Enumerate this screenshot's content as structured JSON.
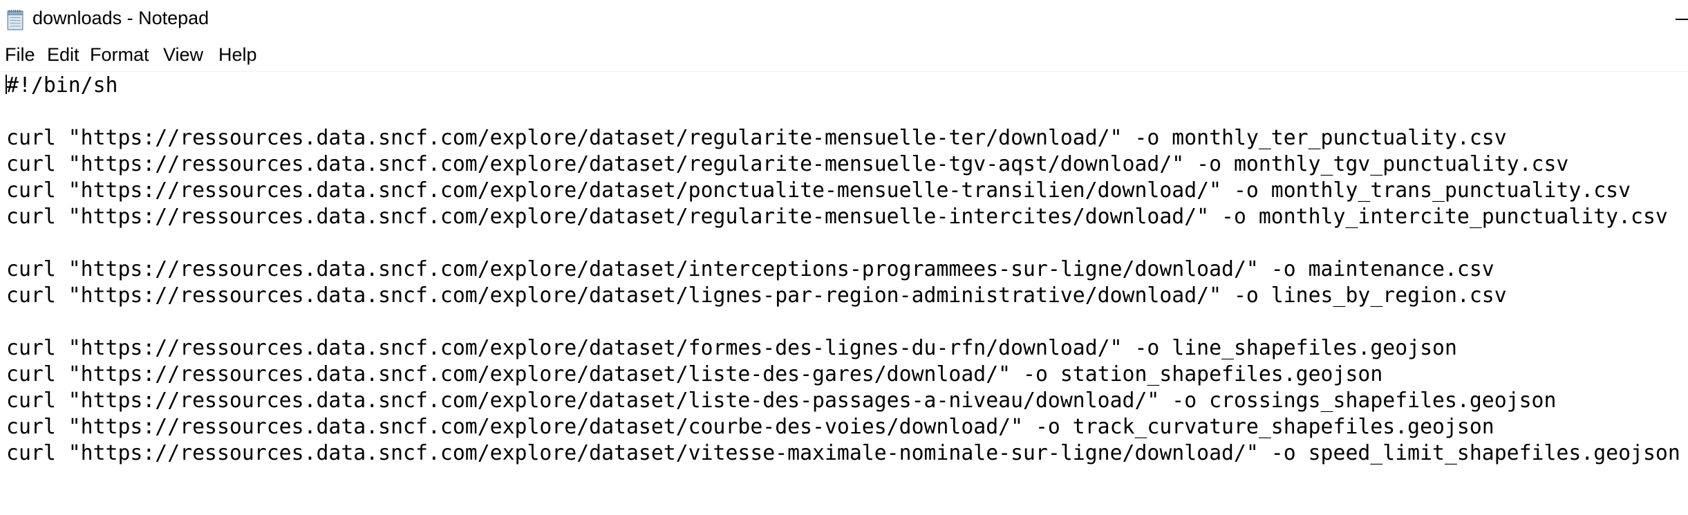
{
  "window": {
    "title": "downloads - Notepad",
    "app_icon": "notepad-icon",
    "minimize_icon": "minimize-icon"
  },
  "menu": {
    "items": [
      "File",
      "Edit",
      "Format",
      "View",
      "Help"
    ]
  },
  "editor": {
    "lines": [
      "#!/bin/sh",
      "",
      "curl \"https://ressources.data.sncf.com/explore/dataset/regularite-mensuelle-ter/download/\" -o monthly_ter_punctuality.csv",
      "curl \"https://ressources.data.sncf.com/explore/dataset/regularite-mensuelle-tgv-aqst/download/\" -o monthly_tgv_punctuality.csv",
      "curl \"https://ressources.data.sncf.com/explore/dataset/ponctualite-mensuelle-transilien/download/\" -o monthly_trans_punctuality.csv",
      "curl \"https://ressources.data.sncf.com/explore/dataset/regularite-mensuelle-intercites/download/\" -o monthly_intercite_punctuality.csv",
      "",
      "curl \"https://ressources.data.sncf.com/explore/dataset/interceptions-programmees-sur-ligne/download/\" -o maintenance.csv",
      "curl \"https://ressources.data.sncf.com/explore/dataset/lignes-par-region-administrative/download/\" -o lines_by_region.csv",
      "",
      "curl \"https://ressources.data.sncf.com/explore/dataset/formes-des-lignes-du-rfn/download/\" -o line_shapefiles.geojson",
      "curl \"https://ressources.data.sncf.com/explore/dataset/liste-des-gares/download/\" -o station_shapefiles.geojson",
      "curl \"https://ressources.data.sncf.com/explore/dataset/liste-des-passages-a-niveau/download/\" -o crossings_shapefiles.geojson",
      "curl \"https://ressources.data.sncf.com/explore/dataset/courbe-des-voies/download/\" -o track_curvature_shapefiles.geojson",
      "curl \"https://ressources.data.sncf.com/explore/dataset/vitesse-maximale-nominale-sur-ligne/download/\" -o speed_limit_shapefiles.geojson"
    ]
  }
}
